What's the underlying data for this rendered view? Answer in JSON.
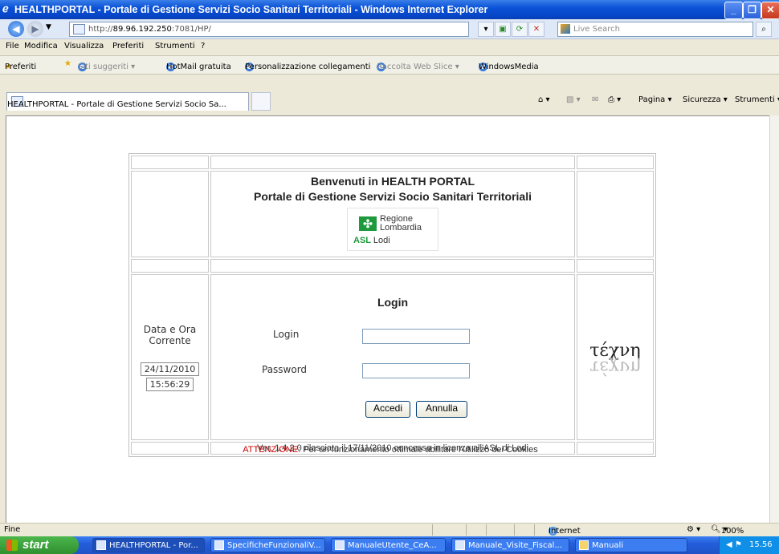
{
  "window": {
    "title": "HEALTHPORTAL - Portale di Gestione Servizi Socio Sanitari Territoriali - Windows Internet Explorer",
    "minimize": "_",
    "maximize": "❐",
    "close": "✕"
  },
  "address_bar": {
    "url_prefix": "http://",
    "url_host": "89.96.192.250",
    "url_rest": ":7081/HP/",
    "search_placeholder": "Live Search"
  },
  "menu": [
    "File",
    "Modifica",
    "Visualizza",
    "Preferiti",
    "Strumenti",
    "?"
  ],
  "favorites_bar": {
    "favorites": "Preferiti",
    "items": [
      "Siti suggeriti ▾",
      "HotMail gratuita",
      "Personalizzazione collegamenti",
      "Raccolta Web Slice ▾",
      "WindowsMedia"
    ]
  },
  "tab": {
    "title": "HEALTHPORTAL - Portale di Gestione Servizi Socio Sa..."
  },
  "command_bar": {
    "page": "Pagina ▾",
    "security": "Sicurezza ▾",
    "tools": "Strumenti ▾"
  },
  "page": {
    "welcome_line1": "Benvenuti in HEALTH PORTAL",
    "welcome_line2": "Portale di Gestione Servizi Socio Sanitari Territoriali",
    "logo": {
      "region_line1": "Regione",
      "region_line2": "Lombardia",
      "asl": "ASL",
      "city": "Lodi"
    },
    "datetime_label_1": "Data e Ora",
    "datetime_label_2": "Corrente",
    "date": "24/11/2010",
    "time": "15:56:29",
    "login_title": "Login",
    "login_label": "Login",
    "password_label": "Password",
    "submit_button": "Accedi",
    "cancel_button": "Annulla",
    "techne_logo": {
      "top_text": "τέχνη",
      "reflection_text": "τέχνη"
    },
    "version_text": "Ver. 1.4.2.0 rilasciata il 17/11/2010 concessa in licenza all'ASL di Lodi",
    "warning_label": "ATTENZIONE:",
    "warning_text": " Per un funzionamento ottimale abilitare l'utilizzo dei Cookies"
  },
  "status_bar": {
    "status": "Fine",
    "zone": "Internet",
    "zoom": "100%"
  },
  "taskbar": {
    "start": "start",
    "items": [
      "HEALTHPORTAL - Por...",
      "SpecificheFunzionaliV...",
      "ManualeUtente_CeA...",
      "Manuale_Visite_Fiscal...",
      "Manuali"
    ],
    "clock": "15.56"
  },
  "colors": {
    "title_bar": "#0b52d8",
    "warning_red": "#cc0000",
    "logo_green": "#1e9a3d"
  }
}
